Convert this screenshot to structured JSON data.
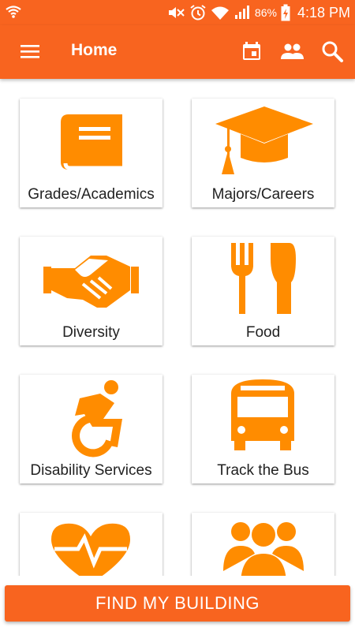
{
  "status_bar": {
    "battery_percent": "86%",
    "time": "4:18 PM",
    "icons": [
      "wifi-calling-icon",
      "mute-icon",
      "alarm-icon",
      "wifi-icon",
      "signal-icon",
      "battery-charging-icon"
    ]
  },
  "app_bar": {
    "title": "Home",
    "actions": [
      "calendar-icon",
      "people-icon",
      "search-icon"
    ]
  },
  "tiles": [
    {
      "label": "Grades/Academics",
      "icon": "book-icon"
    },
    {
      "label": "Majors/Careers",
      "icon": "graduation-cap-icon"
    },
    {
      "label": "Diversity",
      "icon": "handshake-icon"
    },
    {
      "label": "Food",
      "icon": "fork-knife-icon"
    },
    {
      "label": "Disability Services",
      "icon": "accessibility-icon"
    },
    {
      "label": "Track the Bus",
      "icon": "bus-icon"
    },
    {
      "label": "",
      "icon": "heart-pulse-icon"
    },
    {
      "label": "",
      "icon": "group-icon"
    }
  ],
  "bottom_button": {
    "label": "FIND MY BUILDING"
  },
  "colors": {
    "primary": "#f8641f",
    "icon_accent": "#ff8c00"
  }
}
